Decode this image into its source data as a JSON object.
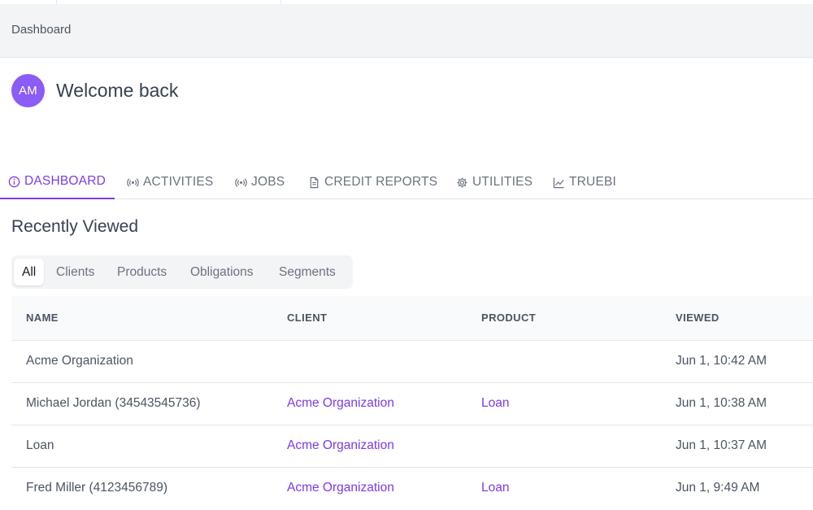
{
  "breadcrumb": "Dashboard",
  "user": {
    "initials": "AM",
    "greeting": "Welcome back"
  },
  "tabs": [
    {
      "label": "DASHBOARD",
      "icon": "info-circle-icon",
      "active": true
    },
    {
      "label": "ACTIVITIES",
      "icon": "broadcast-icon",
      "active": false
    },
    {
      "label": "JOBS",
      "icon": "broadcast-icon",
      "active": false
    },
    {
      "label": "CREDIT REPORTS",
      "icon": "document-icon",
      "active": false
    },
    {
      "label": "UTILITIES",
      "icon": "gear-icon",
      "active": false
    },
    {
      "label": "TRUEBI",
      "icon": "line-chart-icon",
      "active": false
    }
  ],
  "recent": {
    "title": "Recently Viewed",
    "filters": [
      "All",
      "Clients",
      "Products",
      "Obligations",
      "Segments"
    ],
    "selected_filter": "All",
    "columns": [
      "NAME",
      "CLIENT",
      "PRODUCT",
      "VIEWED"
    ],
    "rows": [
      {
        "name": "Acme Organization",
        "client": "",
        "product": "",
        "viewed": "Jun 1, 10:42 AM"
      },
      {
        "name": "Michael Jordan (34543545736)",
        "client": "Acme Organization",
        "product": "Loan",
        "viewed": "Jun 1, 10:38 AM"
      },
      {
        "name": "Loan",
        "client": "Acme Organization",
        "product": "",
        "viewed": "Jun 1, 10:37 AM"
      },
      {
        "name": "Fred Miller (4123456789)",
        "client": "Acme Organization",
        "product": "Loan",
        "viewed": "Jun 1, 9:49 AM"
      }
    ]
  },
  "colors": {
    "accent": "#7c3aed",
    "avatar": "#8b5cf6"
  }
}
